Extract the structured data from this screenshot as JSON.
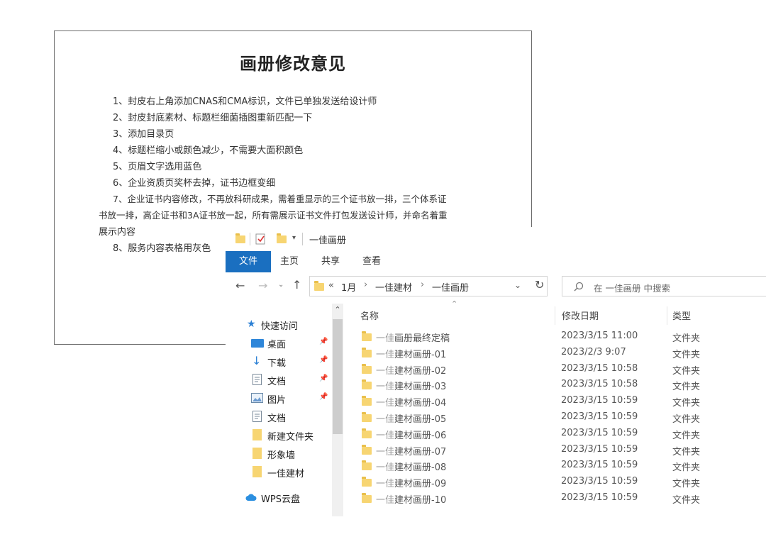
{
  "document": {
    "title": "画册修改意见",
    "lines": [
      "1、封皮右上角添加CNAS和CMA标识，文件已单独发送给设计师",
      "2、封皮封底素材、标题栏细菌插图重新匹配一下",
      "3、添加目录页",
      "4、标题栏缩小或颜色减少，不需要大面积颜色",
      "5、页眉文字选用蓝色",
      "6、企业资质页奖杯去掉，证书边框变细",
      "7、企业证书内容修改，不再放科研成果，需着重显示的三个证书放一排，三个体系证",
      "书放一排，高企证书和3A证书放一起，所有需展示证书文件打包发送设计师，并命名着重",
      "展示内容",
      "8、服务内容表格用灰色"
    ]
  },
  "explorer": {
    "title": "一佳画册",
    "ribbon_tabs": [
      "文件",
      "主页",
      "共享",
      "查看"
    ],
    "address": {
      "prefix": "«",
      "segments": [
        "1月",
        "一佳建材",
        "一佳画册"
      ],
      "separator": "›"
    },
    "search_placeholder": "在 一佳画册 中搜索",
    "nav": [
      {
        "label": "快速访问",
        "icon": "star-icon",
        "pinned": false
      },
      {
        "label": "桌面",
        "icon": "desktop-icon",
        "pinned": true
      },
      {
        "label": "下载",
        "icon": "download-icon",
        "pinned": true
      },
      {
        "label": "文档",
        "icon": "document-icon",
        "pinned": true
      },
      {
        "label": "图片",
        "icon": "picture-icon",
        "pinned": true
      },
      {
        "label": "文档",
        "icon": "document-icon",
        "pinned": false
      },
      {
        "label": "新建文件夹",
        "icon": "folder-icon",
        "pinned": false
      },
      {
        "label": "形象墙",
        "icon": "folder-icon",
        "pinned": false
      },
      {
        "label": "一佳建材",
        "icon": "folder-icon",
        "pinned": false
      },
      {
        "label": "WPS云盘",
        "icon": "cloud-icon",
        "pinned": false
      }
    ],
    "columns": {
      "name": "名称",
      "date": "修改日期",
      "type": "类型"
    },
    "files": [
      {
        "prefix": "一佳",
        "name": "画册最终定稿",
        "date": "2023/3/15 11:00",
        "type": "文件夹"
      },
      {
        "prefix": "一佳",
        "name": "建材画册-01",
        "date": "2023/2/3 9:07",
        "type": "文件夹"
      },
      {
        "prefix": "一佳",
        "name": "建材画册-02",
        "date": "2023/3/15 10:58",
        "type": "文件夹"
      },
      {
        "prefix": "一佳",
        "name": "建材画册-03",
        "date": "2023/3/15 10:58",
        "type": "文件夹"
      },
      {
        "prefix": "一佳",
        "name": "建材画册-04",
        "date": "2023/3/15 10:59",
        "type": "文件夹"
      },
      {
        "prefix": "一佳",
        "name": "建材画册-05",
        "date": "2023/3/15 10:59",
        "type": "文件夹"
      },
      {
        "prefix": "一佳",
        "name": "建材画册-06",
        "date": "2023/3/15 10:59",
        "type": "文件夹"
      },
      {
        "prefix": "一佳",
        "name": "建材画册-07",
        "date": "2023/3/15 10:59",
        "type": "文件夹"
      },
      {
        "prefix": "一佳",
        "name": "建材画册-08",
        "date": "2023/3/15 10:59",
        "type": "文件夹"
      },
      {
        "prefix": "一佳",
        "name": "建材画册-09",
        "date": "2023/3/15 10:59",
        "type": "文件夹"
      },
      {
        "prefix": "一佳",
        "name": "建材画册-10",
        "date": "2023/3/15 10:59",
        "type": "文件夹"
      }
    ],
    "colors": {
      "accent": "#1a6fc0",
      "folder": "#f7d572"
    }
  }
}
